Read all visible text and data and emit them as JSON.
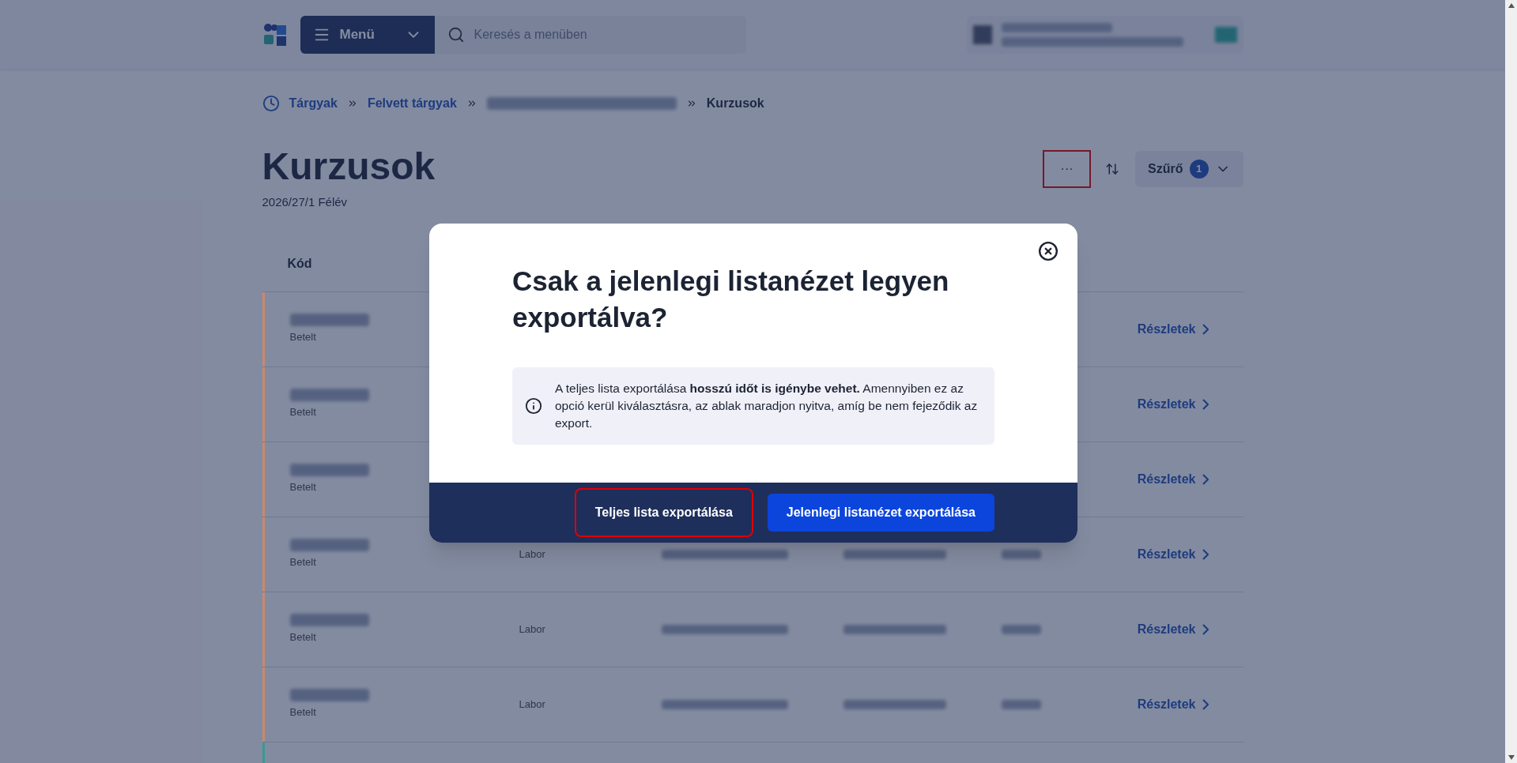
{
  "header": {
    "menu_button": "Menü",
    "search": {
      "placeholder": "Keresés a menüben"
    }
  },
  "breadcrumb": [
    {
      "label": "Tárgyak",
      "kind": "link"
    },
    {
      "label": "Felvett tárgyak",
      "kind": "link"
    },
    {
      "kind": "blurred"
    },
    {
      "label": "Kurzusok",
      "kind": "current"
    }
  ],
  "page": {
    "title": "Kurzusok",
    "subtitle": "2026/27/1 Félév"
  },
  "toolbar": {
    "more_button": {
      "label": "···",
      "highlighted": true
    },
    "filter": {
      "label": "Szűrő",
      "count": "1"
    }
  },
  "table": {
    "columns": [
      "Kód"
    ],
    "rows": [
      {
        "status": "Betelt",
        "color": "#c98a6a",
        "details": "Részletek"
      },
      {
        "status": "Betelt",
        "color": "#c98a6a",
        "details": "Részletek"
      },
      {
        "status": "Betelt",
        "color": "#c98a6a",
        "details": "Részletek"
      },
      {
        "status": "Betelt",
        "color": "#c98a6a",
        "type": "Labor",
        "details": "Részletek"
      },
      {
        "status": "Betelt",
        "color": "#c98a6a",
        "type": "Labor",
        "details": "Részletek"
      },
      {
        "status": "Betelt",
        "color": "#c98a6a",
        "type": "Labor",
        "details": "Részletek"
      },
      {
        "color": "#3a9a94"
      }
    ]
  },
  "dialog": {
    "title": "Csak a jelenlegi listanézet legyen exportálva?",
    "info": "A teljes lista exportálása **hosszú időt is igénybe vehet.** Amennyiben ez az opció kerül kiválasztásra, az ablak maradjon nyitva, amíg be nem fejeződik az export.",
    "buttons": [
      {
        "label": "Teljes lista exportálása",
        "kind": "secondary",
        "highlighted": true
      },
      {
        "label": "Jelenlegi listanézet exportálása",
        "kind": "primary",
        "highlighted": false
      }
    ]
  }
}
